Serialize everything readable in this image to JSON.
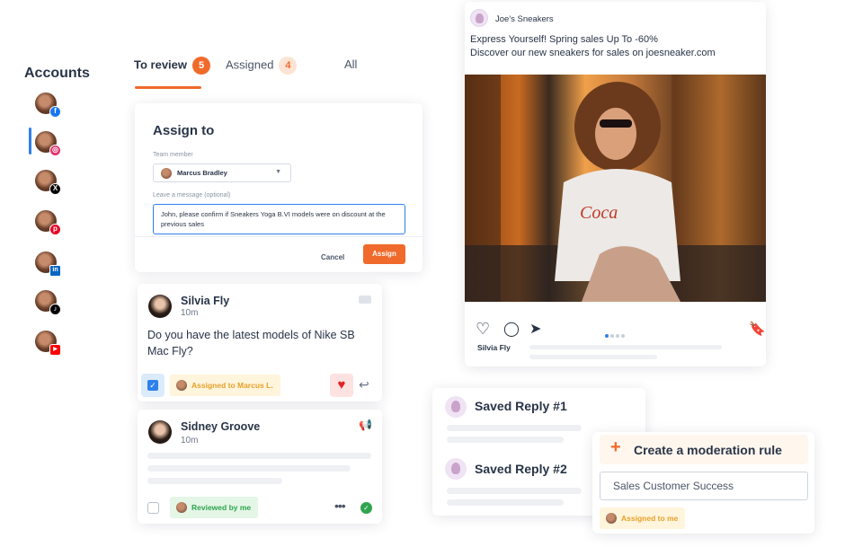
{
  "accounts": {
    "title": "Accounts",
    "items": [
      {
        "network": "facebook",
        "icon": "facebook-icon",
        "color": "#1877f2",
        "glyph": "f"
      },
      {
        "network": "instagram",
        "icon": "instagram-icon",
        "color": "#e1306c",
        "glyph": "◎"
      },
      {
        "network": "x",
        "icon": "x-icon",
        "color": "#000000",
        "glyph": "𝕏"
      },
      {
        "network": "pinterest",
        "icon": "pinterest-icon",
        "color": "#e60023",
        "glyph": "p"
      },
      {
        "network": "linkedin",
        "icon": "linkedin-icon",
        "color": "#0a66c2",
        "glyph": "in"
      },
      {
        "network": "tiktok",
        "icon": "tiktok-icon",
        "color": "#000000",
        "glyph": "♪"
      },
      {
        "network": "youtube",
        "icon": "youtube-icon",
        "color": "#ff0000",
        "glyph": "▶"
      }
    ],
    "selected": "instagram"
  },
  "tabs": [
    {
      "label": "To review",
      "count": "5",
      "active": true
    },
    {
      "label": "Assigned",
      "count": "4",
      "active": false
    },
    {
      "label": "All",
      "count": "",
      "active": false
    }
  ],
  "assign_dialog": {
    "title": "Assign to",
    "member_label": "Team member",
    "member_value": "Marcus Bradley",
    "message_label": "Leave a message (optional)",
    "message_value": "John, please confirm if Sneakers Yoga B.VI models were on discount at the previous sales",
    "cancel_label": "Cancel",
    "assign_label": "Assign"
  },
  "conversations": [
    {
      "name": "Silvia Fly",
      "time": "10m",
      "message": "Do you have the latest models of Nike SB Mac Fly?",
      "chip": "Assigned to Marcus L.",
      "checked": true
    },
    {
      "name": "Sidney Groove",
      "time": "10m",
      "chip": "Reviewed by me",
      "checked": false
    }
  ],
  "post": {
    "brand": "Joe's Sneakers",
    "text_line1": "Express Yourself! Spring sales Up To -60%",
    "text_line2": "Discover our new sneakers for sales on joesneaker.com",
    "liked_by": "Silvia Fly",
    "carousel_total": 4,
    "carousel_current": 1
  },
  "saved_replies": [
    {
      "title": "Saved Reply #1"
    },
    {
      "title": "Saved Reply #2"
    }
  ],
  "moderation": {
    "title": "Create a moderation rule",
    "input_value": "Sales Customer Success",
    "chip": "Assigned to me"
  },
  "colors": {
    "accent": "#f06a2b",
    "primary_blue": "#2f80ed",
    "text": "#283447"
  }
}
